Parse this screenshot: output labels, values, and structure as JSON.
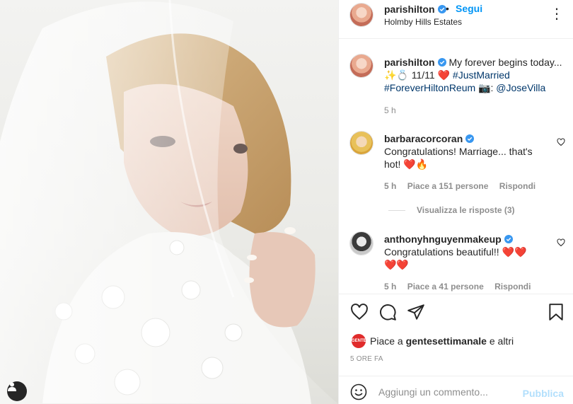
{
  "post": {
    "author": "parishilton",
    "follow_label": "Segui",
    "separator": "•",
    "location": "Holmby Hills Estates",
    "more_label": "⋮"
  },
  "caption": {
    "username": "parishilton",
    "line1": "My forever begins today...",
    "line2": "✨💍 11/11 ❤️",
    "hashtag1": "#JustMarried",
    "hashtag2": "#ForeverHiltonReum",
    "camera": "📷:",
    "mention": "@JoseVilla",
    "time": "5 h"
  },
  "comments": [
    {
      "username": "barbaracorcoran",
      "text_line1": "Congratulations! Marriage... that's",
      "text_line2": "hot! ❤️🔥",
      "time": "5 h",
      "likes": "Piace a 151 persone",
      "reply": "Rispondi",
      "view_replies": "Visualizza le risposte (3)"
    },
    {
      "username": "anthonyhnguyenmakeup",
      "text_line1": "Congratulations beautiful!! ❤️❤️",
      "text_line2": "❤️❤️",
      "time": "5 h",
      "likes": "Piace a 41 persone",
      "reply": "Rispondi"
    }
  ],
  "likes": {
    "badge": "GENTE",
    "prefix": "Piace a",
    "account": "gentesettimanale",
    "suffix": "e altri"
  },
  "time_ago": "5 ORE FA",
  "add_comment": {
    "placeholder": "Aggiungi un commento...",
    "publish": "Pubblica"
  },
  "colors": {
    "accent": "#0095f6",
    "publish_disabled": "#b2dffc",
    "muted": "#8e8e8e",
    "heart_red": "#ed4956"
  }
}
